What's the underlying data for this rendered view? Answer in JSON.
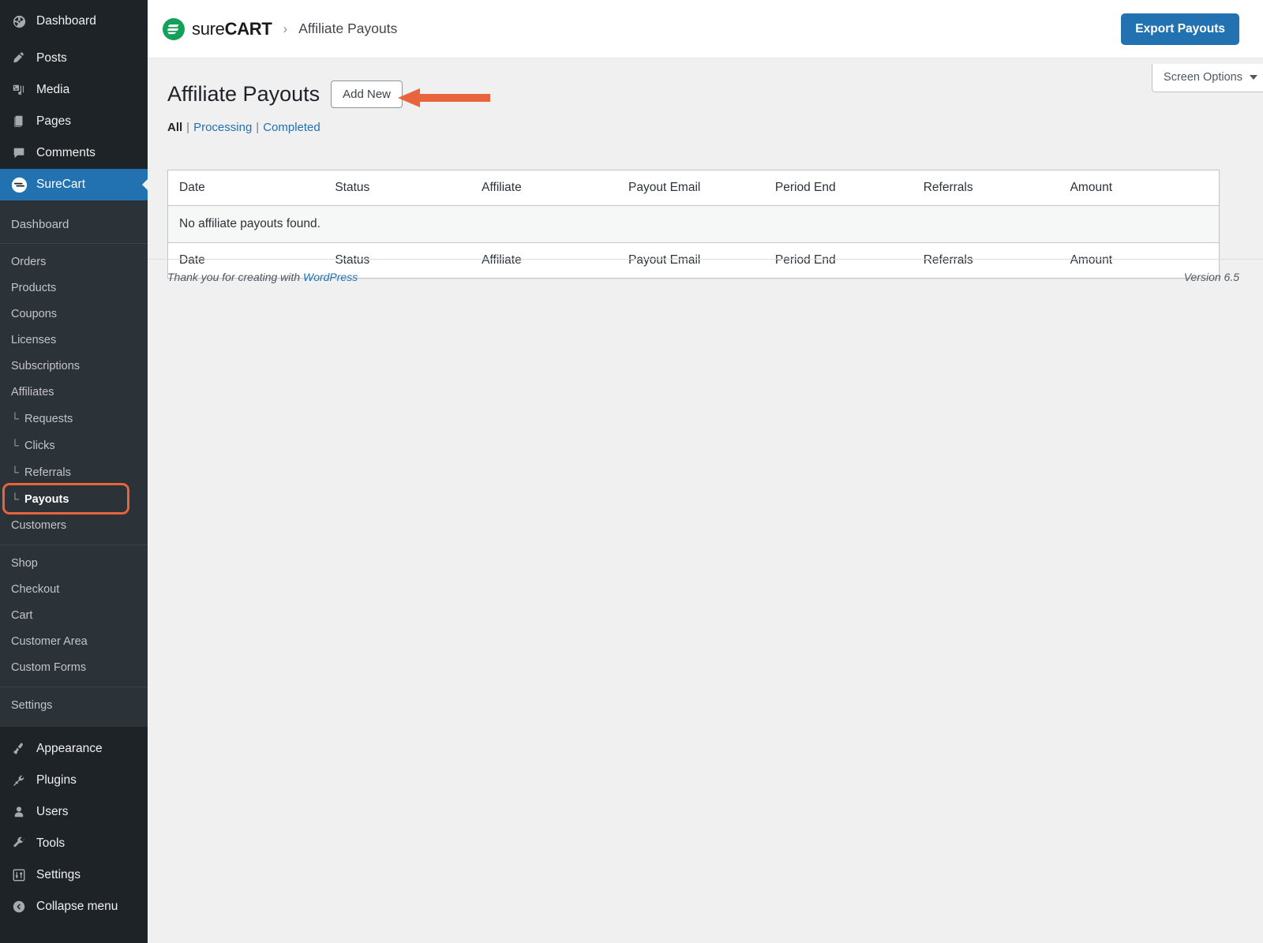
{
  "sidebar": {
    "top_items": [
      {
        "label": "Dashboard",
        "icon": "dashboard-icon"
      },
      {
        "label": "Posts",
        "icon": "pin-icon"
      },
      {
        "label": "Media",
        "icon": "media-icon"
      },
      {
        "label": "Pages",
        "icon": "pages-icon"
      },
      {
        "label": "Comments",
        "icon": "comments-icon"
      }
    ],
    "active_item": {
      "label": "SureCart",
      "icon": "surecart-icon"
    },
    "submenu_group_1": [
      {
        "label": "Dashboard",
        "prefix": ""
      }
    ],
    "submenu_group_2": [
      {
        "label": "Orders",
        "prefix": ""
      },
      {
        "label": "Products",
        "prefix": ""
      },
      {
        "label": "Coupons",
        "prefix": ""
      },
      {
        "label": "Licenses",
        "prefix": ""
      },
      {
        "label": "Subscriptions",
        "prefix": ""
      },
      {
        "label": "Affiliates",
        "prefix": ""
      },
      {
        "label": "Requests",
        "prefix": "└"
      },
      {
        "label": "Clicks",
        "prefix": "└"
      },
      {
        "label": "Referrals",
        "prefix": "└"
      },
      {
        "label": "Payouts",
        "prefix": "└",
        "highlighted": true
      },
      {
        "label": "Customers",
        "prefix": ""
      }
    ],
    "submenu_group_3": [
      {
        "label": "Shop",
        "prefix": ""
      },
      {
        "label": "Checkout",
        "prefix": ""
      },
      {
        "label": "Cart",
        "prefix": ""
      },
      {
        "label": "Customer Area",
        "prefix": ""
      },
      {
        "label": "Custom Forms",
        "prefix": ""
      }
    ],
    "submenu_group_4": [
      {
        "label": "Settings",
        "prefix": ""
      }
    ],
    "bottom_items": [
      {
        "label": "Appearance",
        "icon": "paintbrush-icon"
      },
      {
        "label": "Plugins",
        "icon": "plug-icon"
      },
      {
        "label": "Users",
        "icon": "user-icon"
      },
      {
        "label": "Tools",
        "icon": "wrench-icon"
      },
      {
        "label": "Settings",
        "icon": "settings-sliders-icon"
      },
      {
        "label": "Collapse menu",
        "icon": "collapse-arrow-icon"
      }
    ]
  },
  "header": {
    "brand_sure": "sure",
    "brand_cart": "CART",
    "breadcrumb_separator": "›",
    "breadcrumb_current": "Affiliate Payouts",
    "export_button": "Export Payouts",
    "brand_color": "#15a05a",
    "accent_color": "#2271b1"
  },
  "screen_options": {
    "label": "Screen Options"
  },
  "page": {
    "title": "Affiliate Payouts",
    "add_new_button": "Add New",
    "annotation_color": "#e8643c"
  },
  "filters": {
    "all": "All",
    "separator": "|",
    "processing": "Processing",
    "completed": "Completed"
  },
  "table": {
    "columns": [
      "Date",
      "Status",
      "Affiliate",
      "Payout Email",
      "Period End",
      "Referrals",
      "Amount"
    ],
    "empty_message": "No affiliate payouts found.",
    "rows": []
  },
  "footer": {
    "thanks_prefix": "Thank you for creating with ",
    "wordpress_link": "WordPress",
    "version": "Version 6.5"
  }
}
